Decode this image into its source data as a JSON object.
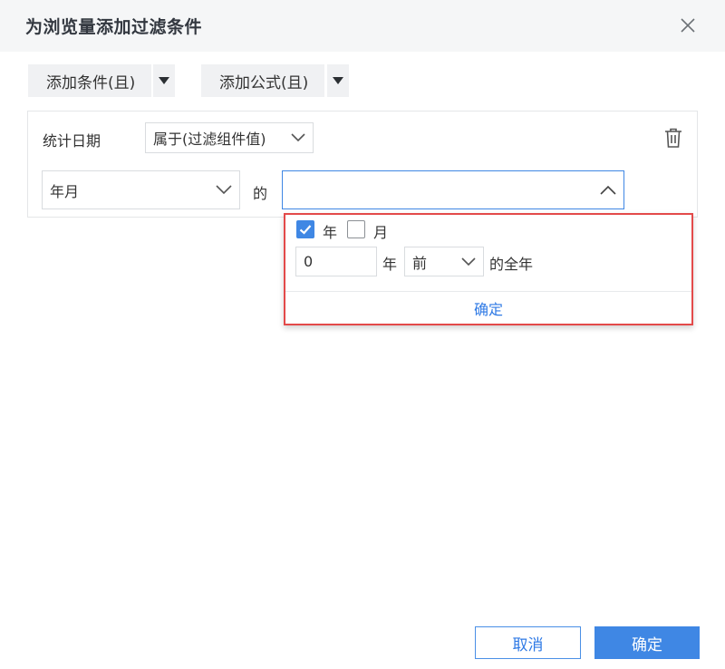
{
  "dialog": {
    "title": "为浏览量添加过滤条件"
  },
  "toolbar": {
    "add_condition_label": "添加条件(且)",
    "add_formula_label": "添加公式(且)"
  },
  "condition": {
    "field_label": "统计日期",
    "operator_value": "属于(过滤组件值)",
    "granularity_value": "年月",
    "of_label": "的",
    "value_select": ""
  },
  "popup": {
    "year_checkbox": {
      "label": "年",
      "checked": true
    },
    "month_checkbox": {
      "label": "月",
      "checked": false
    },
    "offset_value": "0",
    "unit_label": "年",
    "direction_value": "前",
    "suffix_label": "的全年",
    "confirm_label": "确定"
  },
  "footer": {
    "cancel_label": "取消",
    "ok_label": "确定"
  },
  "colors": {
    "accent": "#3f87e4",
    "highlight_border": "#e34a4a"
  }
}
